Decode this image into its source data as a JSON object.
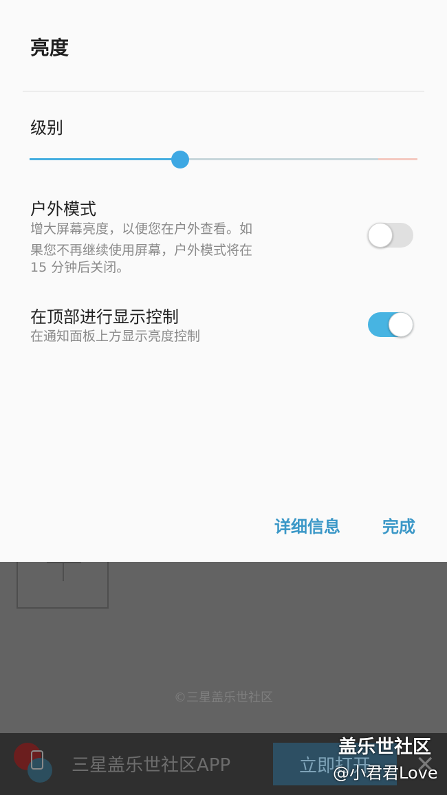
{
  "dialog": {
    "title": "亮度",
    "level_label": "级别",
    "brightness_level": 0.388,
    "outdoor": {
      "title": "户外模式",
      "desc_lines": [
        "增大屏幕亮度，以便您在户外查看。如",
        "果您不再继续使用屏幕，户外模式将在",
        "15 分钟后关闭。"
      ],
      "enabled": false
    },
    "top_control": {
      "title": "在顶部进行显示控制",
      "desc": "在通知面板上方显示亮度控制",
      "enabled": true
    },
    "details_label": "详细信息",
    "done_label": "完成"
  },
  "background": {
    "copyright": "©三星盖乐世社区",
    "banner_text": "三星盖乐世社区APP",
    "banner_button": "立即打开",
    "close_glyph": "✕"
  },
  "watermark": {
    "line1": "盖乐世社区",
    "line2": "@小君君Love"
  },
  "colors": {
    "accent": "#45aee0",
    "action_text": "#3a97c7",
    "toggle_on": "#47b4e2"
  }
}
